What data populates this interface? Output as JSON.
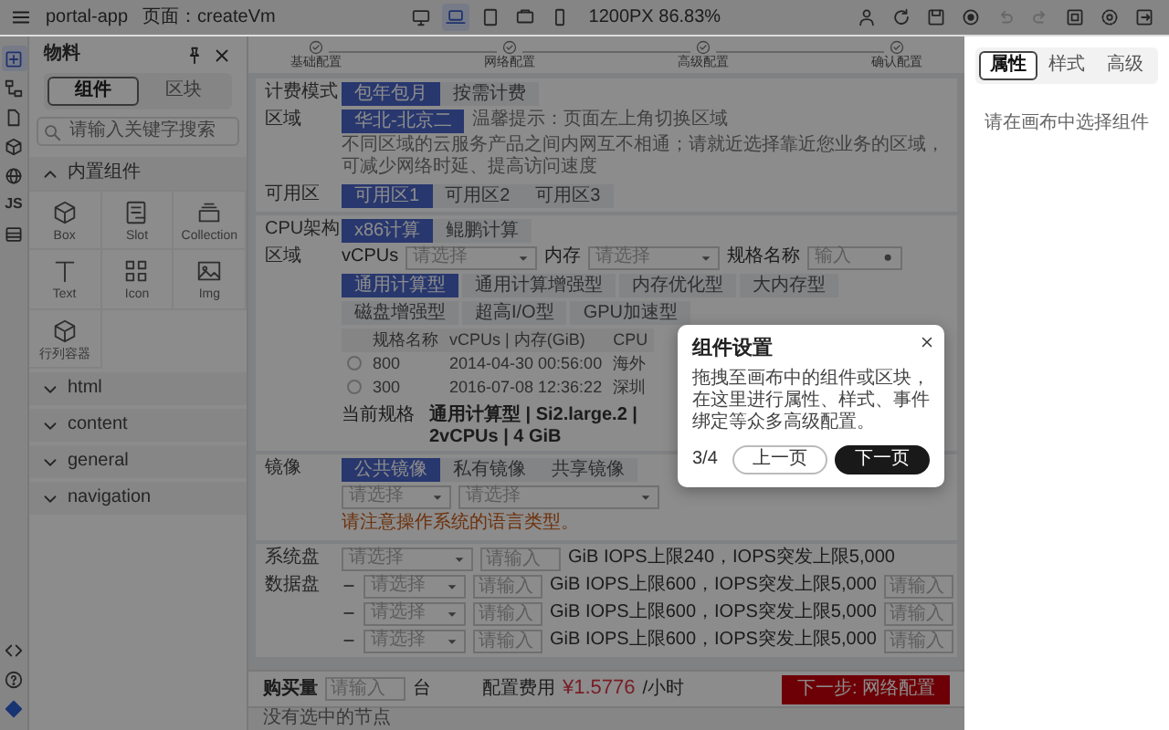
{
  "topbar": {
    "app": "portal-app",
    "page": "页面：createVm",
    "devices": [
      {
        "kind": "desktop",
        "selected": false
      },
      {
        "kind": "laptop",
        "selected": true
      },
      {
        "kind": "tablet",
        "selected": false
      },
      {
        "kind": "landscape",
        "selected": false
      },
      {
        "kind": "phone",
        "selected": false
      }
    ],
    "zoom": "1200PX  86.83%",
    "tools": [
      {
        "kind": "user",
        "disabled": false
      },
      {
        "kind": "refresh",
        "disabled": false
      },
      {
        "kind": "save",
        "disabled": false
      },
      {
        "kind": "preview",
        "disabled": false
      },
      {
        "kind": "undo",
        "disabled": true
      },
      {
        "kind": "redo",
        "disabled": true
      },
      {
        "kind": "fullscreen",
        "disabled": false
      },
      {
        "kind": "settings",
        "disabled": false
      },
      {
        "kind": "exit",
        "disabled": false
      }
    ]
  },
  "rail": {
    "top": [
      {
        "kind": "add",
        "selected": true
      },
      {
        "kind": "tree",
        "selected": false
      },
      {
        "kind": "file",
        "selected": false
      },
      {
        "kind": "cube",
        "selected": false
      },
      {
        "kind": "globe",
        "selected": false
      },
      {
        "kind": "js",
        "label": "JS",
        "selected": false
      },
      {
        "kind": "storage",
        "selected": false
      }
    ],
    "bottom": [
      {
        "kind": "code"
      },
      {
        "kind": "help"
      },
      {
        "kind": "logo"
      }
    ]
  },
  "materials": {
    "title": "物料",
    "tabs": [
      {
        "label": "组件",
        "selected": true
      },
      {
        "label": "区块",
        "selected": false
      }
    ],
    "search": {
      "placeholder": "请输入关键字搜索"
    },
    "groups": [
      {
        "title": "内置组件",
        "expanded": true,
        "items": [
          {
            "label": "Box",
            "kind": "box"
          },
          {
            "label": "Slot",
            "kind": "slot"
          },
          {
            "label": "Collection",
            "kind": "collection"
          },
          {
            "label": "Text",
            "kind": "text"
          },
          {
            "label": "Icon",
            "kind": "icon"
          },
          {
            "label": "Img",
            "kind": "img"
          },
          {
            "label": "行列容器",
            "kind": "box"
          }
        ]
      },
      {
        "title": "html",
        "expanded": false
      },
      {
        "title": "content",
        "expanded": false
      },
      {
        "title": "general",
        "expanded": false
      },
      {
        "title": "navigation",
        "expanded": false
      }
    ]
  },
  "steps": [
    {
      "label": "基础配置"
    },
    {
      "label": "网络配置"
    },
    {
      "label": "高级配置"
    },
    {
      "label": "确认配置"
    }
  ],
  "billing": {
    "label": "计费模式",
    "options": [
      {
        "label": "包年包月",
        "selected": true
      },
      {
        "label": "按需计费",
        "selected": false
      }
    ]
  },
  "region": {
    "label": "区域",
    "options": [
      {
        "label": "华北-北京二",
        "selected": true
      }
    ],
    "hint": "温馨提示：页面左上角切换区域",
    "note": "不同区域的云服务产品之间内网互不相通；请就近选择靠近您业务的区域，可减少网络时延、提高访问速度"
  },
  "zone": {
    "label": "可用区",
    "options": [
      {
        "label": "可用区1",
        "selected": true
      },
      {
        "label": "可用区2",
        "selected": false
      },
      {
        "label": "可用区3",
        "selected": false
      }
    ]
  },
  "cpu_arch": {
    "label": "CPU架构",
    "options": [
      {
        "label": "x86计算",
        "selected": true
      },
      {
        "label": "鲲鹏计算",
        "selected": false
      }
    ]
  },
  "spec_filter": {
    "label": "区域",
    "vcpus_label": "vCPUs",
    "vcpus_placeholder": "请选择",
    "memory_label": "内存",
    "memory_placeholder": "请选择",
    "name_label": "规格名称",
    "name_placeholder": "输入"
  },
  "spec_tabs": [
    {
      "label": "通用计算型",
      "selected": true
    },
    {
      "label": "通用计算增强型",
      "selected": false
    },
    {
      "label": "内存优化型",
      "selected": false
    },
    {
      "label": "大内存型",
      "selected": false
    },
    {
      "label": "磁盘增强型",
      "selected": false
    },
    {
      "label": "超高I/O型",
      "selected": false
    },
    {
      "label": "GPU加速型",
      "selected": false
    }
  ],
  "spec_table": {
    "columns": [
      "规格名称",
      "vCPUs | 内存(GiB)",
      "CPU"
    ],
    "rows": [
      {
        "selected": false,
        "cells": [
          "800",
          "2014-04-30 00:56:00",
          "海外"
        ]
      },
      {
        "selected": false,
        "cells": [
          "300",
          "2016-07-08 12:36:22",
          "深圳"
        ]
      }
    ]
  },
  "current_spec": {
    "label": "当前规格",
    "value": "通用计算型 | Si2.large.2 | 2vCPUs | 4 GiB"
  },
  "image": {
    "label": "镜像",
    "options": [
      {
        "label": "公共镜像",
        "selected": true
      },
      {
        "label": "私有镜像",
        "selected": false
      },
      {
        "label": "共享镜像",
        "selected": false
      }
    ],
    "selects": [
      "请选择",
      "请选择"
    ],
    "warning": "请注意操作系统的语言类型。"
  },
  "system_disk": {
    "label": "系统盘",
    "select": "请选择",
    "size_placeholder": "请输入",
    "info": "GiB IOPS上限240，IOPS突发上限5,000"
  },
  "data_disk": {
    "label": "数据盘",
    "rows": [
      {
        "select": "请选择",
        "size_placeholder": "请输入",
        "info": "GiB IOPS上限600，IOPS突发上限5,000",
        "extra_placeholder": "请输入"
      },
      {
        "select": "请选择",
        "size_placeholder": "请输入",
        "info": "GiB IOPS上限600，IOPS突发上限5,000",
        "extra_placeholder": "请输入"
      },
      {
        "select": "请选择",
        "size_placeholder": "请输入",
        "info": "GiB IOPS上限600，IOPS突发上限5,000",
        "extra_placeholder": "请输入"
      }
    ]
  },
  "purchase": {
    "quantity_label": "购买量",
    "quantity_placeholder": "请输入",
    "unit": "台",
    "fee_label": "配置费用",
    "fee": "¥1.5776",
    "fee_unit": "/小时",
    "next": "下一步: 网络配置"
  },
  "status_bar": "没有选中的节点",
  "properties": {
    "tabs": [
      {
        "label": "属性",
        "selected": true
      },
      {
        "label": "样式",
        "selected": false
      },
      {
        "label": "高级",
        "selected": false
      }
    ],
    "empty": "请在画布中选择组件"
  },
  "tour": {
    "title": "组件设置",
    "text": "拖拽至画布中的组件或区块，在这里进行属性、样式、事件绑定等众多高级配置。",
    "progress": "3/4",
    "prev": "上一页",
    "next": "下一页"
  }
}
